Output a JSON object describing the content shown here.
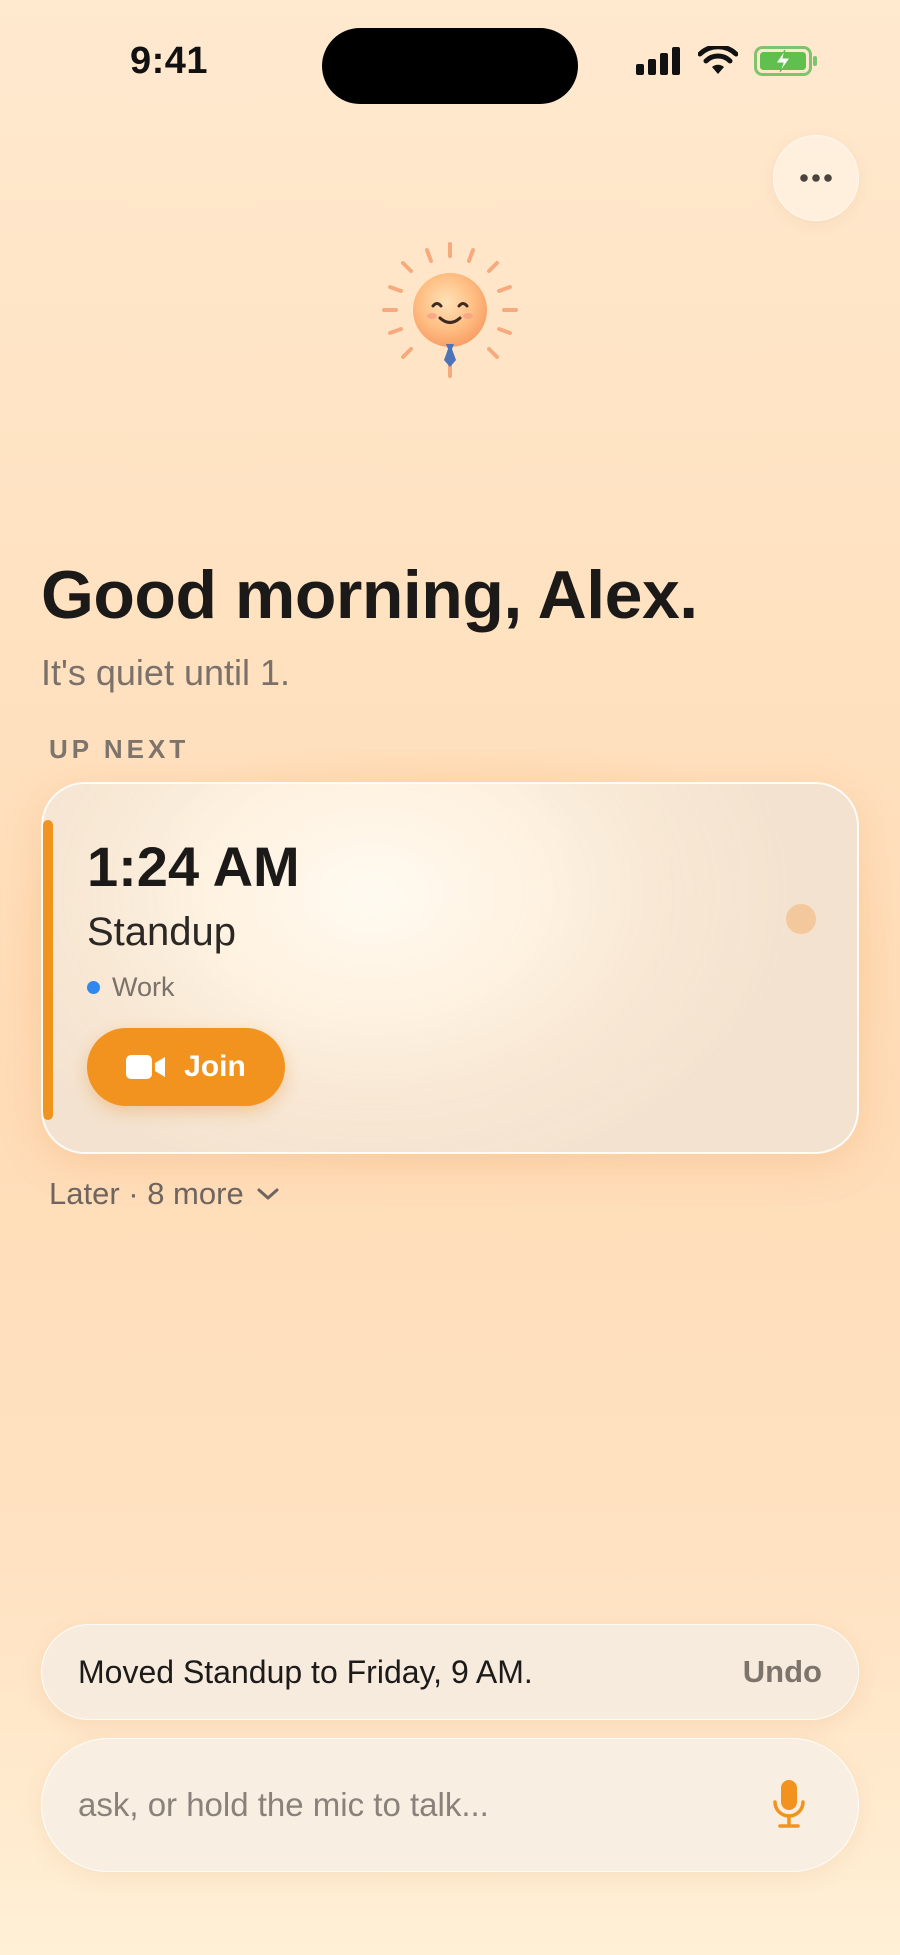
{
  "status_bar": {
    "time": "9:41",
    "icons": [
      "cellular-signal-icon",
      "wifi-icon",
      "battery-charging-icon"
    ]
  },
  "header": {
    "more_icon": "ellipsis-icon",
    "mascot": "sun-mascot"
  },
  "greeting": {
    "title": "Good morning, Alex.",
    "subtitle": "It's quiet until 1."
  },
  "up_next": {
    "label": "UP NEXT",
    "event": {
      "time": "1:24 AM",
      "title": "Standup",
      "calendar": "Work",
      "calendar_color": "#2f87f0",
      "join_label": "Join",
      "join_icon": "video-camera-icon"
    },
    "later_label": "Later · 8 more"
  },
  "toast": {
    "message": "Moved Standup to Friday, 9 AM.",
    "action": "Undo"
  },
  "composer": {
    "placeholder": "ask, or hold the mic to talk...",
    "mic_icon": "microphone-icon"
  },
  "colors": {
    "accent": "#f29320",
    "background": "#ffe2c1"
  }
}
